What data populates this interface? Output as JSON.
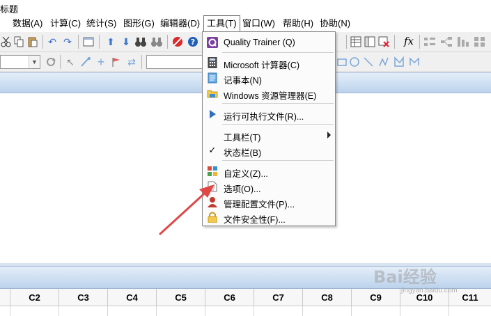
{
  "window": {
    "title_fragment": "标题"
  },
  "menubar": {
    "items": [
      {
        "label": "数据(A)"
      },
      {
        "label": "计算(C)"
      },
      {
        "label": "统计(S)"
      },
      {
        "label": "图形(G)"
      },
      {
        "label": "编辑器(D)"
      },
      {
        "label": "工具(T)"
      },
      {
        "label": "窗口(W)"
      },
      {
        "label": "帮助(H)"
      },
      {
        "label": "协助(N)"
      }
    ],
    "active": "工具(T)"
  },
  "tools_menu": {
    "items": [
      {
        "label": "Quality Trainer (Q)",
        "icon": "quality-trainer-icon"
      },
      {
        "label": "Microsoft 计算器(C)",
        "icon": "calculator-icon"
      },
      {
        "label": "记事本(N)",
        "icon": "notepad-icon"
      },
      {
        "label": "Windows 资源管理器(E)",
        "icon": "explorer-folder-icon"
      },
      {
        "label": "运行可执行文件(R)...",
        "icon": "run-arrow-icon"
      },
      {
        "label": "工具栏(T)",
        "icon": "",
        "has_submenu": true
      },
      {
        "label": "状态栏(B)",
        "icon": "checkmark-icon",
        "checked": true
      },
      {
        "label": "自定义(Z)...",
        "icon": "customize-icon"
      },
      {
        "label": "选项(O)...",
        "icon": "options-document-icon"
      },
      {
        "label": "管理配置文件(P)...",
        "icon": "profile-user-icon"
      },
      {
        "label": "文件安全性(F)...",
        "icon": "lock-icon"
      }
    ]
  },
  "worksheet": {
    "columns": [
      "C2",
      "C3",
      "C4",
      "C5",
      "C6",
      "C7",
      "C8",
      "C9",
      "C10",
      "C11"
    ]
  },
  "watermark": {
    "text": "Bai经验",
    "sub": "jingyan.baidu.com"
  },
  "colors": {
    "panel_header_top": "#e4eef9",
    "panel_header_bottom": "#bcd3ec",
    "annotation_arrow": "#e04848",
    "quality_trainer": "#7b3fa0"
  }
}
